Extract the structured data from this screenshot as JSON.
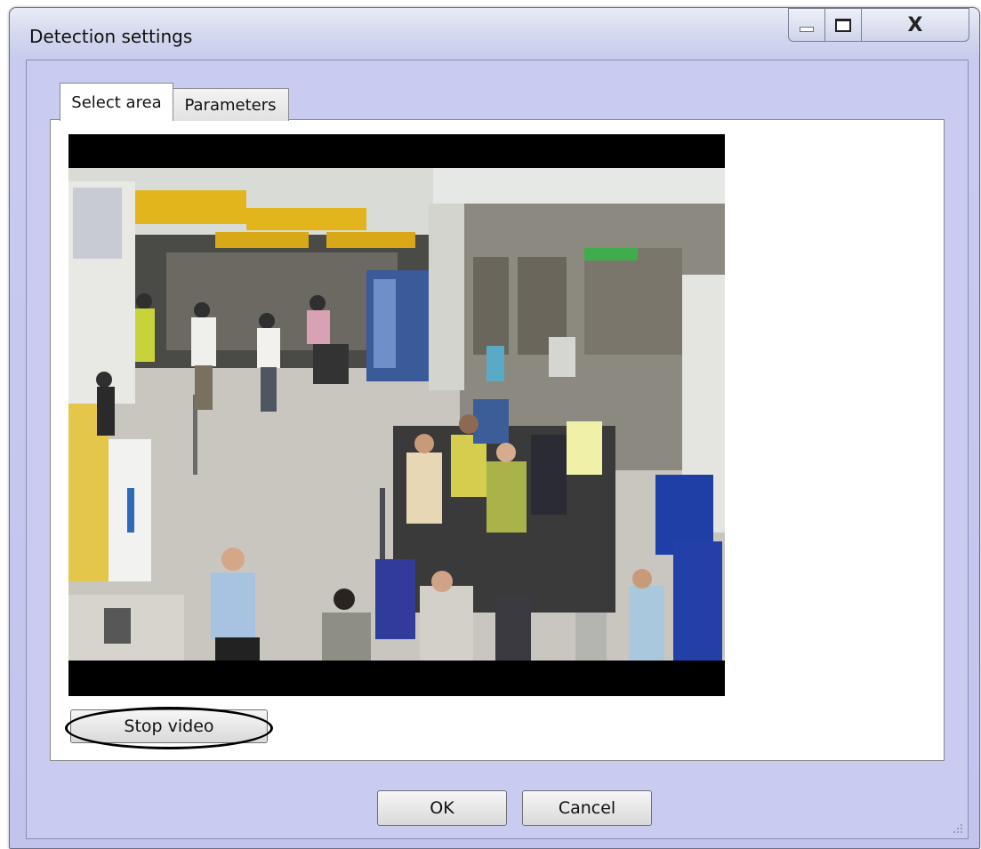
{
  "window": {
    "title": "Detection settings"
  },
  "tabs": [
    {
      "label": "Select area",
      "active": true
    },
    {
      "label": "Parameters",
      "active": false
    }
  ],
  "video": {
    "stop_label": "Stop video"
  },
  "footer": {
    "ok_label": "OK",
    "cancel_label": "Cancel"
  },
  "colors": {
    "window_bg": "#c9cbf0",
    "panel_bg": "#ffffff"
  }
}
